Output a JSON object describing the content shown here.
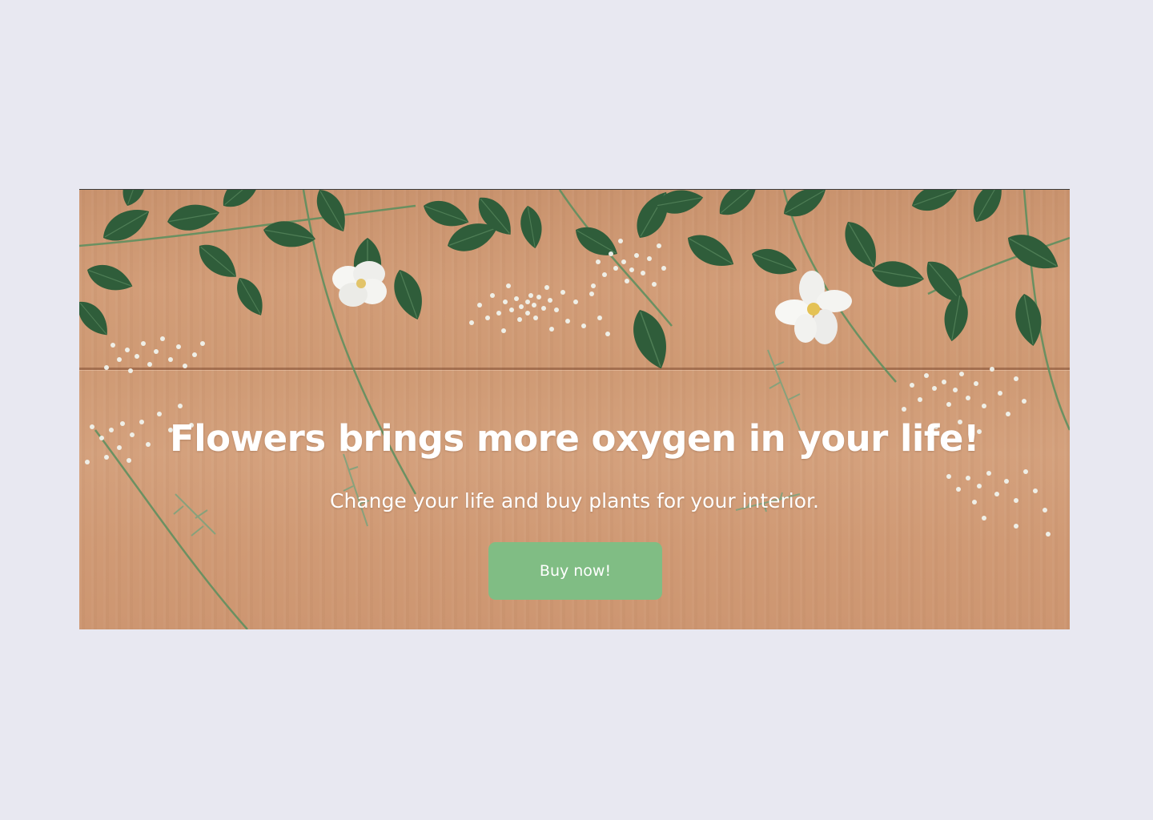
{
  "hero": {
    "headline": "Flowers brings more oxygen in your life!",
    "subheadline": "Change your life and buy plants for your interior.",
    "cta_label": "Buy now!",
    "background_image": "flowers-on-wooden-table-image"
  },
  "colors": {
    "page_background": "#e8e8f1",
    "button": "#80bd84",
    "text": "#ffffff",
    "leaf": "#2f5d3a",
    "wood": "#d29d78"
  }
}
